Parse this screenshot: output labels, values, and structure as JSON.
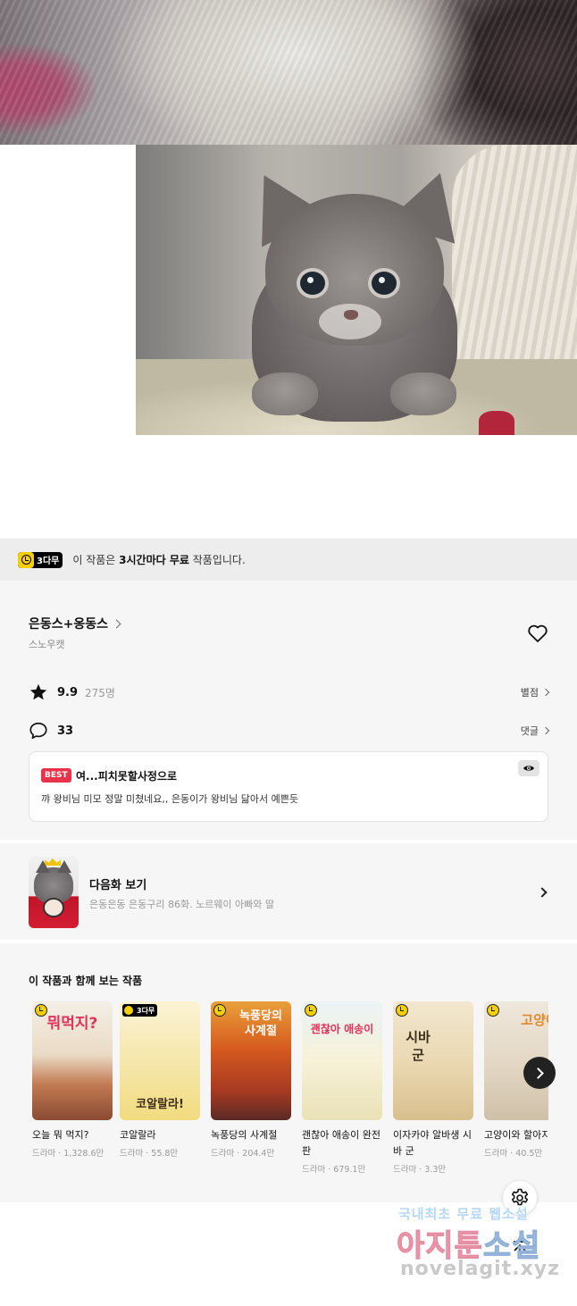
{
  "notice": {
    "badge": "3다무",
    "prefix": "이 작품은 ",
    "emphasis": "3시간마다 무료",
    "suffix": " 작품입니다."
  },
  "series": {
    "title": "은동스+옹동스",
    "author": "스노우캣",
    "rating": "9.9",
    "rating_count": "275명",
    "rating_link": "별점",
    "comment_count": "33",
    "comment_link": "댓글"
  },
  "best_comment": {
    "badge": "BEST",
    "author": "여...피치못할사정으로",
    "text": "꺄 왕비님 미모 정말 미쳤네요,, 은동이가 왕비님 닮아서 예쁜듯"
  },
  "next_episode": {
    "label": "다음화 보기",
    "subtitle": "은동은동 은동구리 86화. 노르웨이 아빠와 딸"
  },
  "recommended": {
    "heading": "이 작품과 함께 보는 작품",
    "items": [
      {
        "name": "오늘 뭐 먹지?",
        "meta": "드라마 · 1,328.6만",
        "cover_text": "뭐먹지?",
        "badge": "clock"
      },
      {
        "name": "코알랄라",
        "meta": "드라마 · 55.8만",
        "cover_text": "코알랄라!",
        "badge": "3다무"
      },
      {
        "name": "녹풍당의 사계절",
        "meta": "드라마 · 204.4만",
        "cover_text": "녹풍당의 사계절",
        "badge": "clock"
      },
      {
        "name": "괜찮아 애송이 완전판",
        "meta": "드라마 · 679.1만",
        "cover_text": "괜찮아 애송이",
        "badge": "clock"
      },
      {
        "name": "이자카야 알바생 시바 군",
        "meta": "드라마 · 3.3만",
        "cover_text": "시바 군",
        "badge": "clock"
      },
      {
        "name": "고양이와 할아지",
        "meta": "드라마 · 40.5만",
        "cover_text": "고양이",
        "badge": "clock"
      }
    ]
  },
  "watermark": {
    "line1_a": "국내최초 무료 ",
    "line1_b": "웹소설",
    "line2_a": "아지툰",
    "line2_b": "소설",
    "line3": "novelagit.xyz"
  },
  "colors": {
    "accent_yellow": "#f5d000",
    "best_red": "#e8334a",
    "panel_bg": "#f6f6f6"
  }
}
